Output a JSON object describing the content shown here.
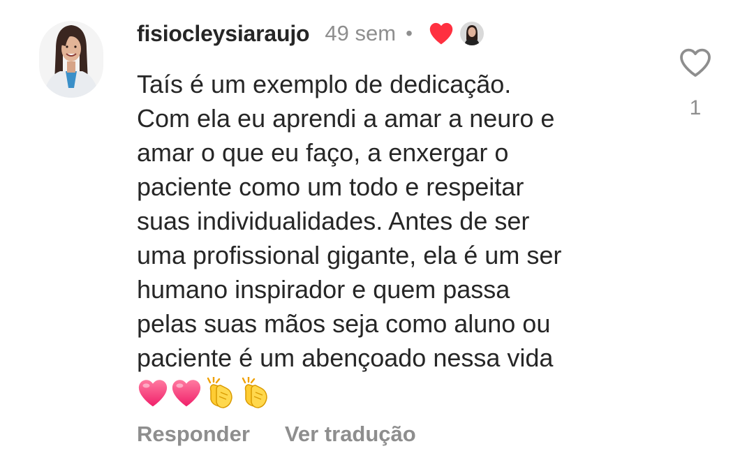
{
  "comment": {
    "username": "fisiocleysiaraujo",
    "time": "49 sem",
    "separator": "•",
    "author_like_icon": "heart-red-icon",
    "body_lines": [
      "Taís é um exemplo de dedicação.",
      "Com ela eu aprendi a amar a neuro e",
      "amar o que eu faço, a enxergar o",
      "paciente como um todo e respeitar",
      "suas individualidades. Antes de ser",
      "uma profissional gigante, ela é um ser",
      "humano inspirador e quem passa",
      "pelas suas mãos seja como aluno ou",
      "paciente é um abençoado nessa vida"
    ],
    "emojis": [
      "pink-heart-emoji",
      "pink-heart-emoji",
      "clapping-hands-emoji",
      "clapping-hands-emoji"
    ],
    "actions": {
      "reply": "Responder",
      "translate": "Ver tradução"
    },
    "likes": {
      "icon": "heart-outline-icon",
      "count": "1"
    }
  },
  "colors": {
    "text": "#262626",
    "muted": "#8e8e8e",
    "heart_red": "#ff3040",
    "background": "#ffffff"
  }
}
